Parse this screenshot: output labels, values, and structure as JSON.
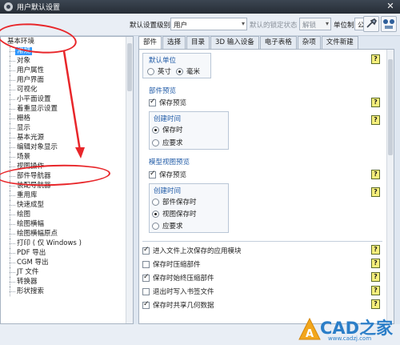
{
  "window": {
    "title": "用户默认设置",
    "close_glyph": "✕"
  },
  "toolbar": {
    "level_label": "默认设置级别",
    "level_value": "用户",
    "lock_label": "默认的锁定状态",
    "lock_value": "解锁",
    "unit_label": "单位制",
    "unit_value": "公制"
  },
  "tree": {
    "root": "基本环境",
    "items": [
      "常规",
      "对象",
      "用户属性",
      "用户界面",
      "可视化",
      "小平面设置",
      "着重显示设置",
      "栅格",
      "显示",
      "基本光源",
      "编辑对象显示",
      "场景",
      "视图操作",
      "部件导航器",
      "装配导航器",
      "重用库",
      "快速成型",
      "绘图",
      "绘图横幅",
      "绘图横幅原点",
      "打印 ( 仅 Windows )",
      "PDF 导出",
      "CGM 导出",
      "JT 文件",
      "转换器",
      "形状搜索"
    ],
    "selected_index": 0
  },
  "tabs": [
    "部件",
    "选择",
    "目录",
    "3D 输入设备",
    "电子表格",
    "杂项",
    "文件新建"
  ],
  "active_tab": 0,
  "content": {
    "default_units": {
      "title": "默认单位",
      "opt1": "英寸",
      "opt2": "毫米",
      "selected": "毫米"
    },
    "part_preview": {
      "title": "部件预览",
      "save_preview": "保存预览",
      "create_time_title": "创建时间",
      "opt_save": "保存时",
      "opt_request": "应要求",
      "selected": "保存时"
    },
    "model_view_preview": {
      "title": "模型视图预览",
      "save_preview": "保存预览",
      "create_time_title": "创建时间",
      "opt1": "部件保存时",
      "opt2": "视图保存时",
      "opt3": "应要求",
      "selected": "视图保存时"
    },
    "options": [
      {
        "label": "进入文件上次保存的应用模块",
        "checked": true
      },
      {
        "label": "保存时压缩部件",
        "checked": false
      },
      {
        "label": "保存时始终压缩部件",
        "checked": true
      },
      {
        "label": "退出时写入书签文件",
        "checked": false
      },
      {
        "label": "保存时共享几何数据",
        "checked": true
      }
    ],
    "help_glyph": "?"
  },
  "watermark": {
    "brand": "CAD之家",
    "url": "www.cadzj.com"
  },
  "colors": {
    "annotation_red": "#e8262a",
    "selection_blue": "#3399ff",
    "section_blue": "#1f5aa6"
  }
}
